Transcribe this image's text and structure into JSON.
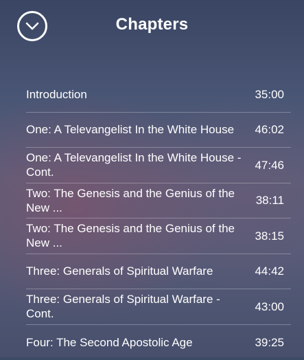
{
  "header": {
    "title": "Chapters",
    "close_icon": "chevron-down-circle-icon"
  },
  "chapters": [
    {
      "title": "Introduction",
      "duration": "35:00"
    },
    {
      "title": "One: A Televangelist In the White House",
      "duration": "46:02"
    },
    {
      "title": "One: A Televangelist In the White House - Cont.",
      "duration": "47:46"
    },
    {
      "title": "Two: The Genesis and the Genius of the New ...",
      "duration": "38:11"
    },
    {
      "title": "Two: The Genesis and the Genius of the New ...",
      "duration": "38:15"
    },
    {
      "title": "Three: Generals of Spiritual Warfare",
      "duration": "44:42"
    },
    {
      "title": "Three: Generals of Spiritual Warfare - Cont.",
      "duration": "43:00"
    },
    {
      "title": "Four: The Second Apostolic Age",
      "duration": "39:25"
    }
  ]
}
